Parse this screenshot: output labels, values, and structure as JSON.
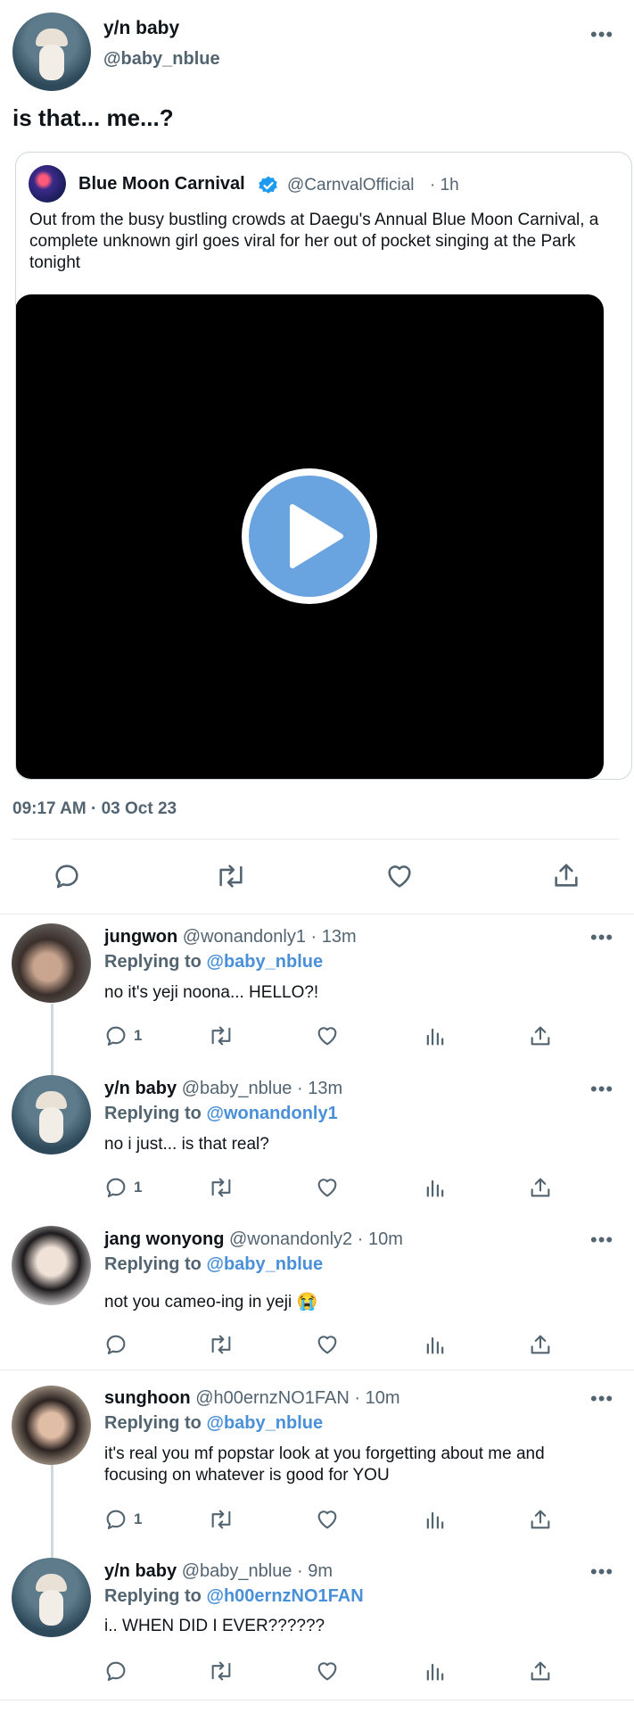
{
  "main_tweet": {
    "display_name": "y/n baby",
    "handle": "@baby_nblue",
    "text": "is that... me...?",
    "timestamp": "09:17 AM · 03 Oct 23"
  },
  "quoted_tweet": {
    "display_name": "Blue Moon Carnival",
    "handle": "@CarnvalOfficial",
    "time": "· 1h",
    "text": "Out from the busy bustling crowds at Daegu's Annual Blue Moon Carnival, a complete unknown girl goes viral for her out of pocket singing at the Park tonight"
  },
  "replies": [
    {
      "name": "jungwon",
      "meta": "@wonandonly1 · 13m",
      "replying_prefix": "Replying to ",
      "replying_to": "@baby_nblue",
      "text": "no it's yeji noona... HELLO?!",
      "reply_count": "1"
    },
    {
      "name": "y/n baby",
      "meta": "@baby_nblue · 13m",
      "replying_prefix": "Replying to ",
      "replying_to": "@wonandonly1",
      "text": "no i just... is that real?",
      "reply_count": "1"
    },
    {
      "name": "jang wonyong",
      "meta": "@wonandonly2 · 10m",
      "replying_prefix": "Replying to ",
      "replying_to": "@baby_nblue",
      "text": "not you cameo-ing in yeji 😭",
      "reply_count": ""
    },
    {
      "name": "sunghoon",
      "meta": "@h00ernzNO1FAN · 10m",
      "replying_prefix": "Replying to ",
      "replying_to": "@baby_nblue",
      "text": "it's real you mf popstar look at you forgetting about me and focusing on whatever is good for YOU",
      "reply_count": "1"
    },
    {
      "name": "y/n baby",
      "meta": "@baby_nblue · 9m",
      "replying_prefix": "Replying to ",
      "replying_to": "@h00ernzNO1FAN",
      "text": "i.. WHEN DID I EVER??????",
      "reply_count": ""
    }
  ],
  "colors": {
    "accent": "#4a90d9",
    "verified": "#1d9bf0",
    "text": "#0f1419",
    "secondary": "#536471"
  },
  "icons": [
    "more-icon",
    "verified-badge-icon",
    "play-icon",
    "reply-icon",
    "retweet-icon",
    "like-icon",
    "views-icon",
    "share-icon"
  ]
}
